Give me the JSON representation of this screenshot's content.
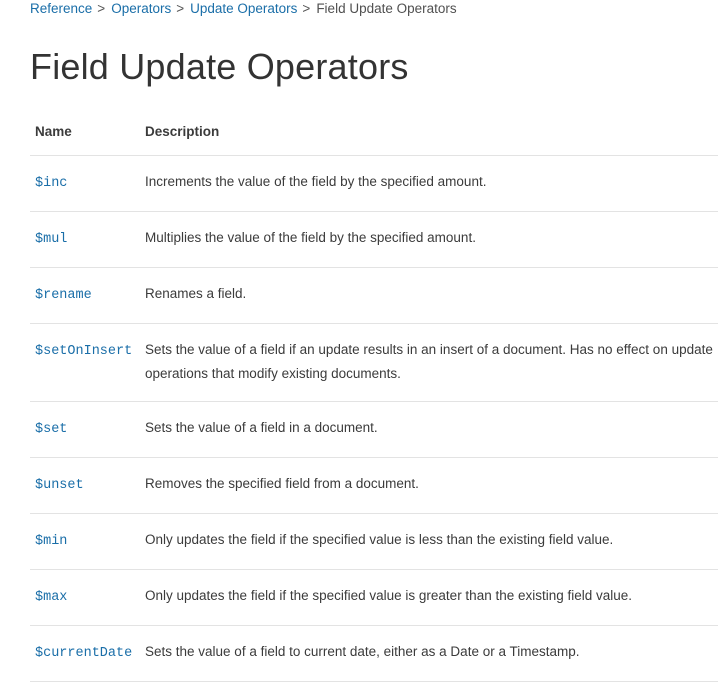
{
  "breadcrumb": {
    "items": [
      "Reference",
      "Operators",
      "Update Operators"
    ],
    "separator": ">",
    "current": "Field Update Operators"
  },
  "page_title": "Field Update Operators",
  "table": {
    "headers": {
      "name": "Name",
      "description": "Description"
    },
    "rows": [
      {
        "name": "$inc",
        "description": "Increments the value of the field by the specified amount."
      },
      {
        "name": "$mul",
        "description": "Multiplies the value of the field by the specified amount."
      },
      {
        "name": "$rename",
        "description": "Renames a field."
      },
      {
        "name": "$setOnInsert",
        "description": "Sets the value of a field if an update results in an insert of a document. Has no effect on update operations that modify existing documents."
      },
      {
        "name": "$set",
        "description": "Sets the value of a field in a document."
      },
      {
        "name": "$unset",
        "description": "Removes the specified field from a document."
      },
      {
        "name": "$min",
        "description": "Only updates the field if the specified value is less than the existing field value."
      },
      {
        "name": "$max",
        "description": "Only updates the field if the specified value is greater than the existing field value."
      },
      {
        "name": "$currentDate",
        "description": "Sets the value of a field to current date, either as a Date or a Timestamp."
      }
    ]
  },
  "colors": {
    "link": "#1a6ea8",
    "text": "#3b3b3b",
    "rule": "#e3e3e3"
  }
}
